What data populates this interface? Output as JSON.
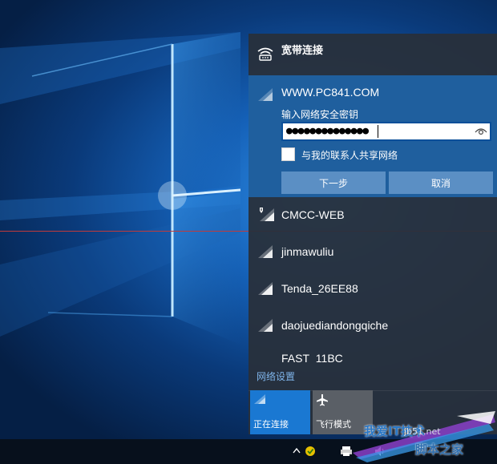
{
  "flyout": {
    "broadband": {
      "label": "宽带连接",
      "icon": "broadband-icon"
    },
    "selected_network": {
      "ssid": "WWW.PC841.COM",
      "key_label": "输入网络安全密钥",
      "password_masked": "●●●●●●●●●●●●●●",
      "share_label": "与我的联系人共享网络",
      "share_checked": false,
      "next_label": "下一步",
      "cancel_label": "取消"
    },
    "networks": [
      {
        "name": "CMCC-WEB",
        "icon": "wifi-secured-warning-icon"
      },
      {
        "name": "jinmawuliu",
        "icon": "wifi-icon"
      },
      {
        "name": "Tenda_26EE88",
        "icon": "wifi-icon"
      },
      {
        "name": "daojuediandongqiche",
        "icon": "wifi-icon"
      },
      {
        "name": "FAST_11BC",
        "icon": "wifi-icon"
      }
    ],
    "settings_label": "网络设置",
    "quick_actions": [
      {
        "label": "正在连接",
        "icon": "wifi-icon",
        "active": true
      },
      {
        "label": "飞行模式",
        "icon": "airplane-icon",
        "active": false
      }
    ]
  },
  "taskbar": {
    "icons": [
      "chevron-up-icon",
      "app-tray-icon",
      "printer-icon",
      "volume-icon"
    ]
  },
  "watermark": {
    "line1": "我爱IT技术",
    "line2": "jb51.net",
    "line3": "脚本之家"
  },
  "colors": {
    "accent": "#1a78d2",
    "selected_bg": "#1f5f9e",
    "flyout_bg": "#28303a",
    "link": "#7fb4ea"
  }
}
